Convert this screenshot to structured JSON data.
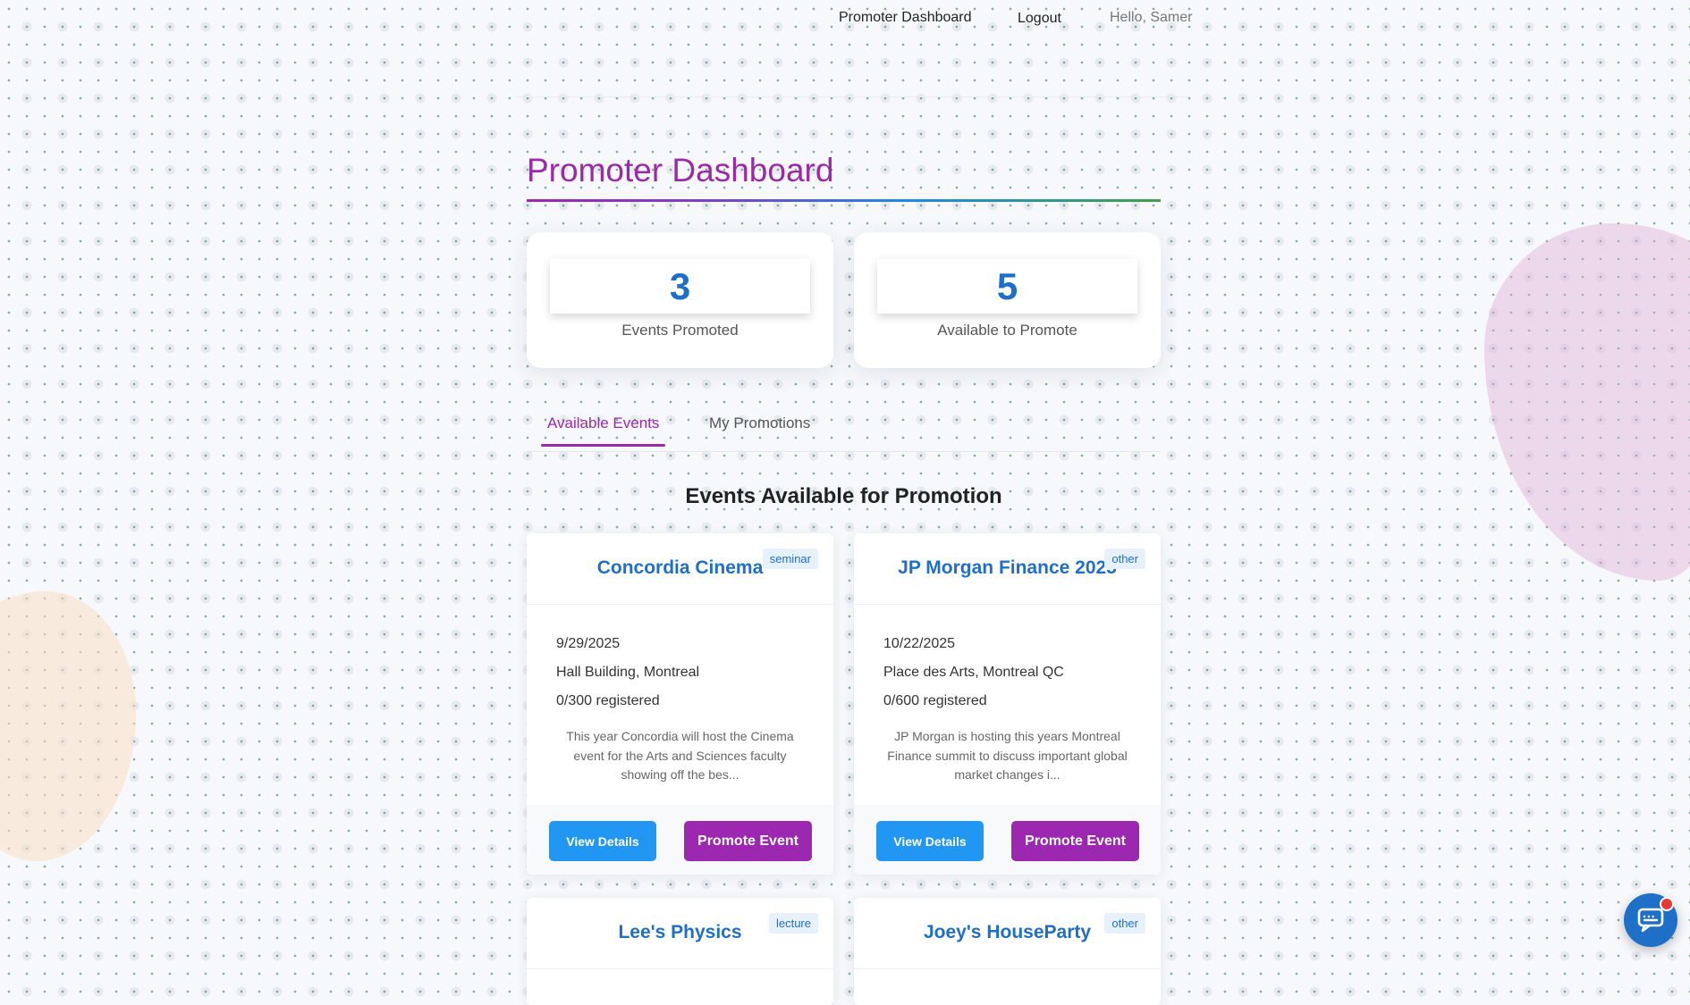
{
  "nav": {
    "dashboard_link": "Promoter Dashboard",
    "logout_link": "Logout",
    "greeting": "Hello, Samer"
  },
  "page": {
    "title": "Promoter Dashboard"
  },
  "stats": [
    {
      "value": "3",
      "label": "Events Promoted"
    },
    {
      "value": "5",
      "label": "Available to Promote"
    }
  ],
  "tabs": [
    {
      "label": "Available Events",
      "active": true
    },
    {
      "label": "My Promotions",
      "active": false
    }
  ],
  "section": {
    "heading": "Events Available for Promotion"
  },
  "events": [
    {
      "title": "Concordia Cinema",
      "category": "seminar",
      "date": "9/29/2025",
      "location": "Hall Building, Montreal",
      "registered": "0/300 registered",
      "description": "This year Concordia will host the Cinema event for the Arts and Sciences faculty showing off the bes...",
      "view_label": "View Details",
      "promote_label": "Promote Event"
    },
    {
      "title": "JP Morgan Finance 2025",
      "category": "other",
      "date": "10/22/2025",
      "location": "Place des Arts, Montreal QC",
      "registered": "0/600 registered",
      "description": "JP Morgan is hosting this years Montreal Finance summit to discuss important global market changes i...",
      "view_label": "View Details",
      "promote_label": "Promote Event"
    },
    {
      "title": "Lee's Physics",
      "category": "lecture"
    },
    {
      "title": "Joey's HouseParty",
      "category": "other"
    }
  ],
  "colors": {
    "accent_purple": "#9c27b0",
    "accent_blue": "#1e6fc8",
    "button_blue": "#2196f3",
    "background": "#f6f8fb"
  },
  "icons": {
    "chat": "chat-bubble-icon",
    "notification": "notification-dot"
  }
}
